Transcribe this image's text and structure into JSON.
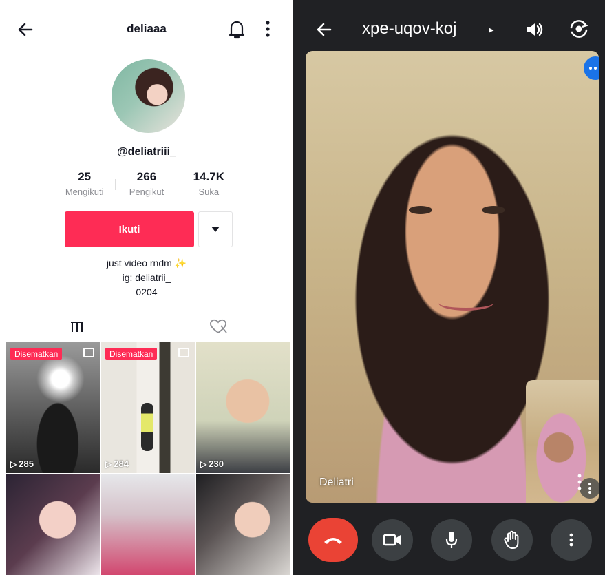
{
  "profile": {
    "username": "deliaaa",
    "handle": "@deliatriii_",
    "stats": [
      {
        "value": "25",
        "label": "Mengikuti"
      },
      {
        "value": "266",
        "label": "Pengikut"
      },
      {
        "value": "14.7K",
        "label": "Suka"
      }
    ],
    "follow_label": "Ikuti",
    "bio_line1": "just video rndm",
    "bio_line2": "ig: deliatrii_",
    "bio_line3": "0204",
    "videos": [
      {
        "pinned_label": "Disematkan",
        "views": "285"
      },
      {
        "pinned_label": "Disematkan",
        "views": "284"
      },
      {
        "views": "230"
      }
    ]
  },
  "call": {
    "meeting_code": "xpe-uqov-koj",
    "caret": "▸",
    "participant_name": "Deliatri",
    "accent_end": "#ea4335",
    "accent_blue": "#1a73e8"
  },
  "colors": {
    "follow_button": "#fe2c55",
    "call_background": "#202124",
    "control_button": "#3c4043"
  },
  "icons": [
    "back-arrow-icon",
    "bell-icon",
    "more-vertical-icon",
    "dropdown-triangle-icon",
    "grid-icon",
    "liked-hidden-icon",
    "photo-icon",
    "play-icon",
    "speaker-icon",
    "camera-switch-icon",
    "end-call-icon",
    "video-camera-icon",
    "microphone-icon",
    "raise-hand-icon"
  ]
}
